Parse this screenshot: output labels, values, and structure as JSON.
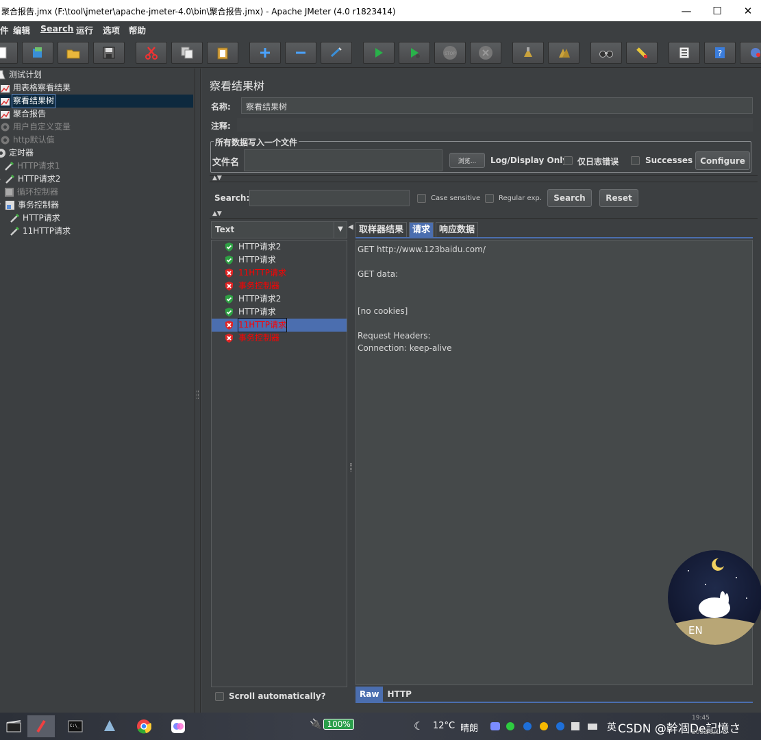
{
  "window": {
    "title": "聚合报告.jmx (F:\\tool\\jmeter\\apache-jmeter-4.0\\bin\\聚合报告.jmx) - Apache JMeter (4.0 r1823414)",
    "min": "—",
    "max": "☐",
    "close": "✕"
  },
  "menu": [
    "件",
    "编辑",
    "Search",
    "运行",
    "选项",
    "帮助"
  ],
  "toolbar": {
    "icons": [
      "new-icon",
      "templates-icon",
      "open-icon",
      "save-icon",
      "cut-icon",
      "copy-icon",
      "paste-icon",
      "expand-icon",
      "collapse-icon",
      "toggle-icon",
      "start-icon",
      "start-no-pause-icon",
      "stop-icon",
      "shutdown-icon",
      "clear-icon",
      "clear-all-icon",
      "search-icon",
      "reset-search-icon",
      "function-helper-icon",
      "help-icon",
      "remote-icon"
    ],
    "stop_label": "STOP"
  },
  "tree": [
    {
      "label": "测试计划",
      "icon": "test-plan-icon"
    },
    {
      "label": "用表格察看结果",
      "icon": "listener-icon"
    },
    {
      "label": "察看结果树",
      "icon": "listener-icon",
      "selected": true
    },
    {
      "label": "聚合报告",
      "icon": "listener-icon"
    },
    {
      "label": "用户自定义变量",
      "icon": "config-gear-icon",
      "disabled": true
    },
    {
      "label": "http默认值",
      "icon": "config-gear-icon",
      "disabled": true
    },
    {
      "label": "定时器",
      "icon": "timer-gear-icon"
    },
    {
      "label": "HTTP请求1",
      "icon": "sampler-pipette-icon",
      "disabled": true
    },
    {
      "label": "HTTP请求2",
      "icon": "sampler-pipette-icon"
    },
    {
      "label": "循环控制器",
      "icon": "loop-controller-icon",
      "disabled": true
    },
    {
      "label": "事务控制器",
      "icon": "transaction-controller-icon"
    },
    {
      "label": "HTTP请求",
      "icon": "sampler-pipette-icon"
    },
    {
      "label": "11HTTP请求",
      "icon": "sampler-pipette-icon"
    }
  ],
  "panel": {
    "title": "察看结果树",
    "name_label": "名称:",
    "name_value": "察看结果树",
    "comment_label": "注释:",
    "group_title": "所有数据写入一个文件",
    "file_label": "文件名",
    "browse": "浏览...",
    "log_display": "Log/Display Only:",
    "errors_only": "仅日志错误",
    "successes": "Successes",
    "configure": "Configure",
    "search_label": "Search:",
    "case_sensitive": "Case sensitive",
    "regex": "Regular exp.",
    "search_btn": "Search",
    "reset_btn": "Reset",
    "renderer": "Text",
    "results": [
      {
        "label": "HTTP请求2",
        "ok": true
      },
      {
        "label": "HTTP请求",
        "ok": true
      },
      {
        "label": "11HTTP请求",
        "ok": false
      },
      {
        "label": "事务控制器",
        "ok": false
      },
      {
        "label": "HTTP请求2",
        "ok": true
      },
      {
        "label": "HTTP请求",
        "ok": true
      },
      {
        "label": "11HTTP请求",
        "ok": false,
        "selected": true
      },
      {
        "label": "事务控制器",
        "ok": false
      }
    ],
    "tabs": [
      "取样器结果",
      "请求",
      "响应数据"
    ],
    "active_tab": 1,
    "request_lines": [
      "GET http://www.123baidu.com/",
      "",
      "GET data:",
      "",
      "",
      "[no cookies]",
      "",
      "Request Headers:",
      "Connection: keep-alive"
    ],
    "bottom_tabs": [
      "Raw",
      "HTTP"
    ],
    "scroll_auto": "Scroll automatically?"
  },
  "taskbar": {
    "battery": "100%",
    "weather_temp": "12°C",
    "weather_desc": "晴朗",
    "ime": "英",
    "watermark": "CSDN @幹凅De記憶さ",
    "time": "19:45",
    "date": "2022/3/1"
  },
  "colors": {
    "bg": "#3c3f41",
    "field": "#45494a",
    "selection": "#4b6eaf",
    "tree_selection": "#0d293e",
    "error_text": "#ff0000",
    "ok_green": "#2ea043",
    "error_red": "#e02424"
  }
}
